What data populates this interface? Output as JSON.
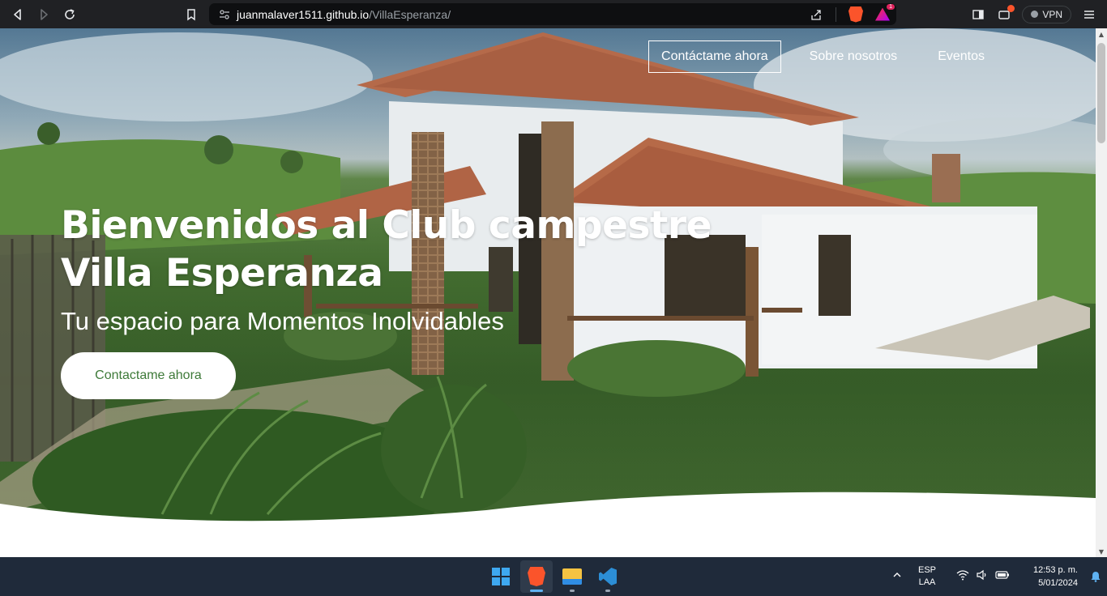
{
  "browser": {
    "url_host": "juanmalaver1511.github.io",
    "url_path": "/VillaEsperanza/",
    "rewards_badge": "1",
    "vpn_label": "VPN"
  },
  "site": {
    "nav": [
      {
        "label": "Contáctame ahora"
      },
      {
        "label": "Sobre nosotros"
      },
      {
        "label": "Eventos"
      }
    ],
    "hero": {
      "title": "Bienvenidos al Club campestre Villa Esperanza",
      "subtitle": "Tu espacio para Momentos Inolvidables",
      "cta_label": "Contactame ahora"
    },
    "colors": {
      "cta_text": "#3e7a39",
      "grass": "#4e7d34"
    }
  },
  "taskbar": {
    "apps": [
      "windows-start",
      "brave-browser",
      "file-explorer",
      "vscode"
    ],
    "lang_line1": "ESP",
    "lang_line2": "LAA",
    "time": "12:53 p. m.",
    "date": "5/01/2024"
  }
}
